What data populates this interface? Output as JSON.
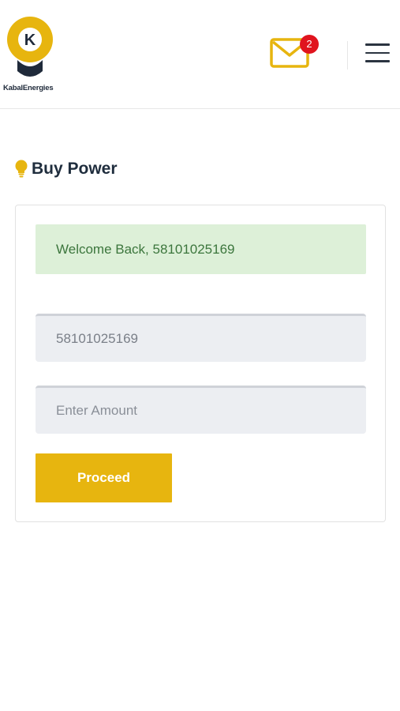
{
  "brand": {
    "logo_letter": "K",
    "name": "KabalEnergies"
  },
  "header": {
    "mail_icon": "envelope-icon",
    "notification_count": "2",
    "menu_icon": "hamburger-menu-icon"
  },
  "page": {
    "title": "Buy Power",
    "title_icon": "lightbulb-icon"
  },
  "form": {
    "welcome_message": "Welcome Back, 58101025169",
    "meter_number_value": "58101025169",
    "amount_placeholder": "Enter Amount",
    "proceed_label": "Proceed"
  },
  "colors": {
    "brand_yellow": "#e7b50f",
    "badge_red": "#e0141e",
    "success_bg": "#ddf0d8",
    "success_text": "#3c763d"
  }
}
